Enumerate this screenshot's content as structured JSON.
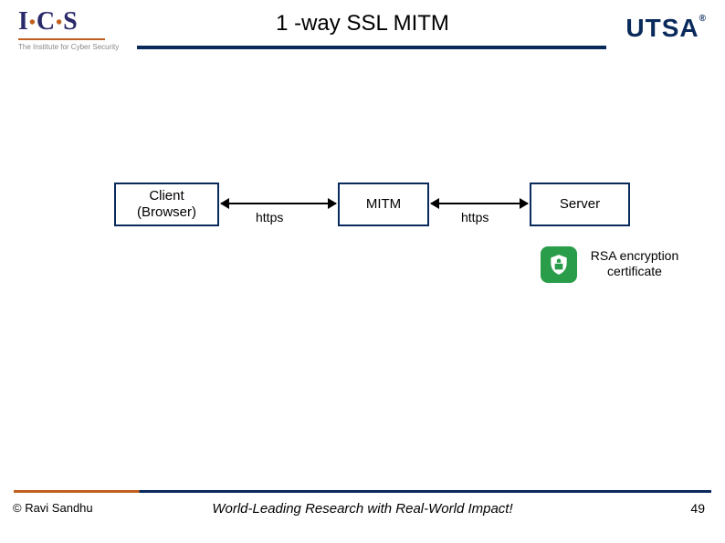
{
  "header": {
    "logo_ics": {
      "main": "I·C·S",
      "sub": "The Institute for Cyber Security"
    },
    "title": "1 -way SSL MITM",
    "logo_utsa": "UTSA"
  },
  "diagram": {
    "client": {
      "line1": "Client",
      "line2": "(Browser)"
    },
    "mitm": "MITM",
    "server": "Server",
    "arrow1_label": "https",
    "arrow2_label": "https",
    "cert_label": {
      "line1": "RSA encryption",
      "line2": "certificate"
    }
  },
  "footer": {
    "copyright": "© Ravi Sandhu",
    "tagline": "World-Leading Research with Real-World Impact!",
    "page": "49"
  }
}
